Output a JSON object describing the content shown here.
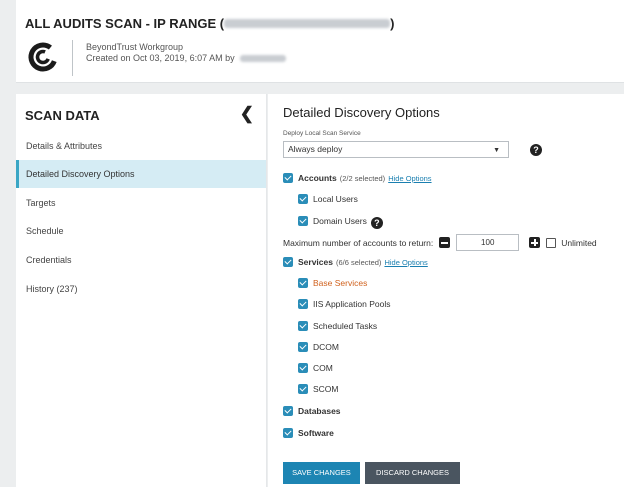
{
  "header": {
    "title": "ALL AUDITS SCAN - IP RANGE (",
    "title_close": ")",
    "organization": "BeyondTrust Workgroup",
    "created_on": "Created on Oct 03, 2019, 6:07 AM by"
  },
  "sidebar": {
    "heading": "SCAN DATA",
    "collapse_icon": "chevron-left-icon",
    "items": [
      {
        "label": "Details & Attributes"
      },
      {
        "label": "Detailed Discovery Options"
      },
      {
        "label": "Targets"
      },
      {
        "label": "Schedule"
      },
      {
        "label": "Credentials"
      },
      {
        "label": "History (237)"
      }
    ],
    "active_index": 1
  },
  "main": {
    "title": "Detailed Discovery Options",
    "deploy_label": "Deploy Local Scan Service",
    "deploy_value": "Always deploy",
    "accounts": {
      "label": "Accounts",
      "count": "(2/2 selected)",
      "hide_link": "Hide Options",
      "local_users": "Local Users",
      "domain_users": "Domain Users",
      "max_label": "Maximum number of accounts to return:",
      "max_value": "100",
      "unlimited_label": "Unlimited"
    },
    "services": {
      "label": "Services",
      "count": "(6/6 selected)",
      "hide_link": "Hide Options",
      "items": [
        "Base Services",
        "IIS Application Pools",
        "Scheduled Tasks",
        "DCOM",
        "COM",
        "SCOM"
      ]
    },
    "databases_label": "Databases",
    "software_label": "Software",
    "save_label": "SAVE CHANGES",
    "discard_label": "DISCARD CHANGES"
  },
  "colors": {
    "accent": "#2a8db8",
    "active_bg": "#d5ecf4",
    "highlight_text": "#d0611d",
    "discard_bg": "#4a5560"
  }
}
